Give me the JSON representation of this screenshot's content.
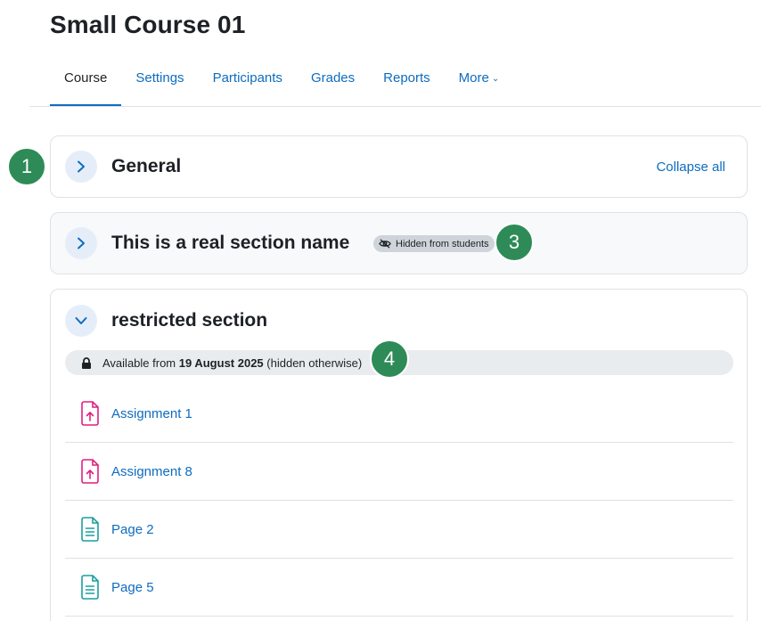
{
  "course": {
    "title": "Small Course 01"
  },
  "tabs": [
    {
      "label": "Course"
    },
    {
      "label": "Settings"
    },
    {
      "label": "Participants"
    },
    {
      "label": "Grades"
    },
    {
      "label": "Reports"
    },
    {
      "label": "More"
    }
  ],
  "sections": {
    "general": {
      "title": "General",
      "collapse_all": "Collapse all"
    },
    "real": {
      "title": "This is a real section name",
      "badge": "Hidden from students"
    },
    "restricted": {
      "title": "restricted section",
      "restriction_prefix": "Available from",
      "restriction_date": "19 August 2025",
      "restriction_suffix": "(hidden otherwise)",
      "activities": [
        {
          "name": "Assignment 1",
          "icon": "assignment-icon"
        },
        {
          "name": "Assignment 8",
          "icon": "assignment-icon"
        },
        {
          "name": "Page 2",
          "icon": "page-icon"
        },
        {
          "name": "Page 5",
          "icon": "page-icon"
        }
      ]
    }
  },
  "callouts": [
    "1",
    "3",
    "4"
  ],
  "colors": {
    "link": "#0f6cbf",
    "callout": "#2e8b57",
    "assignment": "#e01f80",
    "page": "#1b9e9e"
  }
}
